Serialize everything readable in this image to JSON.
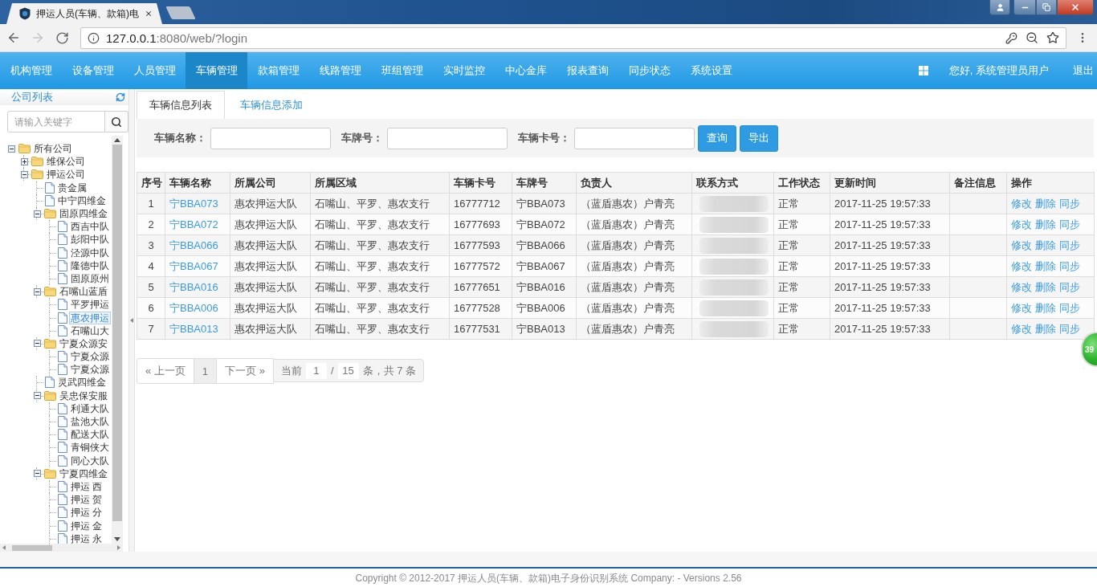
{
  "browser": {
    "tab_title": "押运人员(车辆、款箱)电",
    "url_host": "127.0.0.1",
    "url_rest": ":8080/web/?login"
  },
  "nav": {
    "items": [
      {
        "label": "机构管理",
        "selected": false
      },
      {
        "label": "设备管理",
        "selected": false
      },
      {
        "label": "人员管理",
        "selected": false
      },
      {
        "label": "车辆管理",
        "selected": true
      },
      {
        "label": "款箱管理",
        "selected": false
      },
      {
        "label": "线路管理",
        "selected": false
      },
      {
        "label": "班组管理",
        "selected": false
      },
      {
        "label": "实时监控",
        "selected": false
      },
      {
        "label": "中心金库",
        "selected": false
      },
      {
        "label": "报表查询",
        "selected": false
      },
      {
        "label": "同步状态",
        "selected": false
      },
      {
        "label": "系统设置",
        "selected": false
      }
    ],
    "greeting": "您好, 系统管理员用户",
    "logout": "退出"
  },
  "sidebar": {
    "title": "公司列表",
    "search": {
      "placeholder": "请输入关键字"
    },
    "tree": [
      {
        "label": "所有公司",
        "kind": "folder",
        "expanded": true,
        "selected": false,
        "children": [
          {
            "label": "维保公司",
            "kind": "folder",
            "expanded": false,
            "selected": false
          },
          {
            "label": "押运公司",
            "kind": "folder",
            "expanded": true,
            "selected": false,
            "children": [
              {
                "label": "贵金属",
                "kind": "file",
                "selected": false
              },
              {
                "label": "中宁四维金",
                "kind": "file",
                "selected": false
              },
              {
                "label": "固原四维金",
                "kind": "folder",
                "expanded": true,
                "selected": false,
                "children": [
                  {
                    "label": "西吉中队",
                    "kind": "file",
                    "selected": false
                  },
                  {
                    "label": "彭阳中队",
                    "kind": "file",
                    "selected": false
                  },
                  {
                    "label": "泾源中队",
                    "kind": "file",
                    "selected": false
                  },
                  {
                    "label": "隆德中队",
                    "kind": "file",
                    "selected": false
                  },
                  {
                    "label": "固原原州",
                    "kind": "file",
                    "selected": false
                  }
                ]
              },
              {
                "label": "石嘴山蓝盾",
                "kind": "folder",
                "expanded": true,
                "selected": false,
                "children": [
                  {
                    "label": "平罗押运",
                    "kind": "file",
                    "selected": false
                  },
                  {
                    "label": "惠农押运",
                    "kind": "file",
                    "selected": true
                  },
                  {
                    "label": "石嘴山大",
                    "kind": "file",
                    "selected": false
                  }
                ]
              },
              {
                "label": "宁夏众源安",
                "kind": "folder",
                "expanded": true,
                "selected": false,
                "children": [
                  {
                    "label": "宁夏众源",
                    "kind": "file",
                    "selected": false
                  },
                  {
                    "label": "宁夏众源",
                    "kind": "file",
                    "selected": false
                  }
                ]
              },
              {
                "label": "灵武四维金",
                "kind": "file",
                "selected": false
              },
              {
                "label": "吴忠保安服",
                "kind": "folder",
                "expanded": true,
                "selected": false,
                "children": [
                  {
                    "label": "利通大队",
                    "kind": "file",
                    "selected": false
                  },
                  {
                    "label": "盐池大队",
                    "kind": "file",
                    "selected": false
                  },
                  {
                    "label": "配送大队",
                    "kind": "file",
                    "selected": false
                  },
                  {
                    "label": "青铜侠大",
                    "kind": "file",
                    "selected": false
                  },
                  {
                    "label": "同心大队",
                    "kind": "file",
                    "selected": false
                  }
                ]
              },
              {
                "label": "宁夏四维金",
                "kind": "folder",
                "expanded": true,
                "selected": false,
                "children": [
                  {
                    "label": "押运 西",
                    "kind": "file",
                    "selected": false
                  },
                  {
                    "label": "押运 贺",
                    "kind": "file",
                    "selected": false
                  },
                  {
                    "label": "押运 分",
                    "kind": "file",
                    "selected": false
                  },
                  {
                    "label": "押运 金",
                    "kind": "file",
                    "selected": false
                  },
                  {
                    "label": "押运 永",
                    "kind": "file",
                    "selected": false
                  }
                ]
              }
            ]
          }
        ]
      }
    ]
  },
  "tabs": [
    {
      "label": "车辆信息列表",
      "selected": true
    },
    {
      "label": "车辆信息添加",
      "selected": false
    }
  ],
  "filters": [
    {
      "label": "车辆名称："
    },
    {
      "label": "车牌号："
    },
    {
      "label": "车辆卡号："
    }
  ],
  "buttons": [
    "查询",
    "导出"
  ],
  "table": {
    "columns": [
      "序号",
      "车辆名称",
      "所属公司",
      "所属区域",
      "车辆卡号",
      "车牌号",
      "负责人",
      "联系方式",
      "工作状态",
      "更新时间",
      "备注信息",
      "操作"
    ],
    "rows": [
      {
        "index": "1",
        "name": "宁BBA073",
        "company": "惠农押运大队",
        "area": "石嘴山、平罗、惠农支行",
        "card_no": "16777712",
        "plate": "宁BBA073",
        "owner": "（蓝盾惠农）户青亮",
        "contact_blurred": true,
        "status": "正常",
        "updated": "2017-11-25 19:57:33",
        "actions": [
          "修改",
          "删除",
          "同步"
        ]
      },
      {
        "index": "2",
        "name": "宁BBA072",
        "company": "惠农押运大队",
        "area": "石嘴山、平罗、惠农支行",
        "card_no": "16777693",
        "plate": "宁BBA072",
        "owner": "（蓝盾惠农）户青亮",
        "contact_blurred": true,
        "status": "正常",
        "updated": "2017-11-25 19:57:33",
        "actions": [
          "修改",
          "删除",
          "同步"
        ]
      },
      {
        "index": "3",
        "name": "宁BBA066",
        "company": "惠农押运大队",
        "area": "石嘴山、平罗、惠农支行",
        "card_no": "16777593",
        "plate": "宁BBA066",
        "owner": "（蓝盾惠农）户青亮",
        "contact_blurred": true,
        "status": "正常",
        "updated": "2017-11-25 19:57:33",
        "actions": [
          "修改",
          "删除",
          "同步"
        ]
      },
      {
        "index": "4",
        "name": "宁BBA067",
        "company": "惠农押运大队",
        "area": "石嘴山、平罗、惠农支行",
        "card_no": "16777572",
        "plate": "宁BBA067",
        "owner": "（蓝盾惠农）户青亮",
        "contact_blurred": true,
        "status": "正常",
        "updated": "2017-11-25 19:57:33",
        "actions": [
          "修改",
          "删除",
          "同步"
        ]
      },
      {
        "index": "5",
        "name": "宁BBA016",
        "company": "惠农押运大队",
        "area": "石嘴山、平罗、惠农支行",
        "card_no": "16777651",
        "plate": "宁BBA016",
        "owner": "（蓝盾惠农）户青亮",
        "contact_blurred": true,
        "status": "正常",
        "updated": "2017-11-25 19:57:33",
        "actions": [
          "修改",
          "删除",
          "同步"
        ]
      },
      {
        "index": "6",
        "name": "宁BBA006",
        "company": "惠农押运大队",
        "area": "石嘴山、平罗、惠农支行",
        "card_no": "16777528",
        "plate": "宁BBA006",
        "owner": "（蓝盾惠农）户青亮",
        "contact_blurred": true,
        "status": "正常",
        "updated": "2017-11-25 19:57:33",
        "actions": [
          "修改",
          "删除",
          "同步"
        ]
      },
      {
        "index": "7",
        "name": "宁BBA013",
        "company": "惠农押运大队",
        "area": "石嘴山、平罗、惠农支行",
        "card_no": "16777531",
        "plate": "宁BBA013",
        "owner": "（蓝盾惠农）户青亮",
        "contact_blurred": true,
        "status": "正常",
        "updated": "2017-11-25 19:57:33",
        "actions": [
          "修改",
          "删除",
          "同步"
        ]
      }
    ]
  },
  "pagination": {
    "prev": "« 上一页",
    "pages": [
      {
        "label": "1",
        "selected": true
      }
    ],
    "next": "下一页 »",
    "current_label": "当前",
    "current_page": "1",
    "separator": "/",
    "page_size": "15",
    "summary": "条，共 7 条"
  },
  "float_badge": "39",
  "footer": "Copyright © 2012-2017 押运人员(车辆、款箱)电子身份识别系统 Company: - Versions 2.56"
}
